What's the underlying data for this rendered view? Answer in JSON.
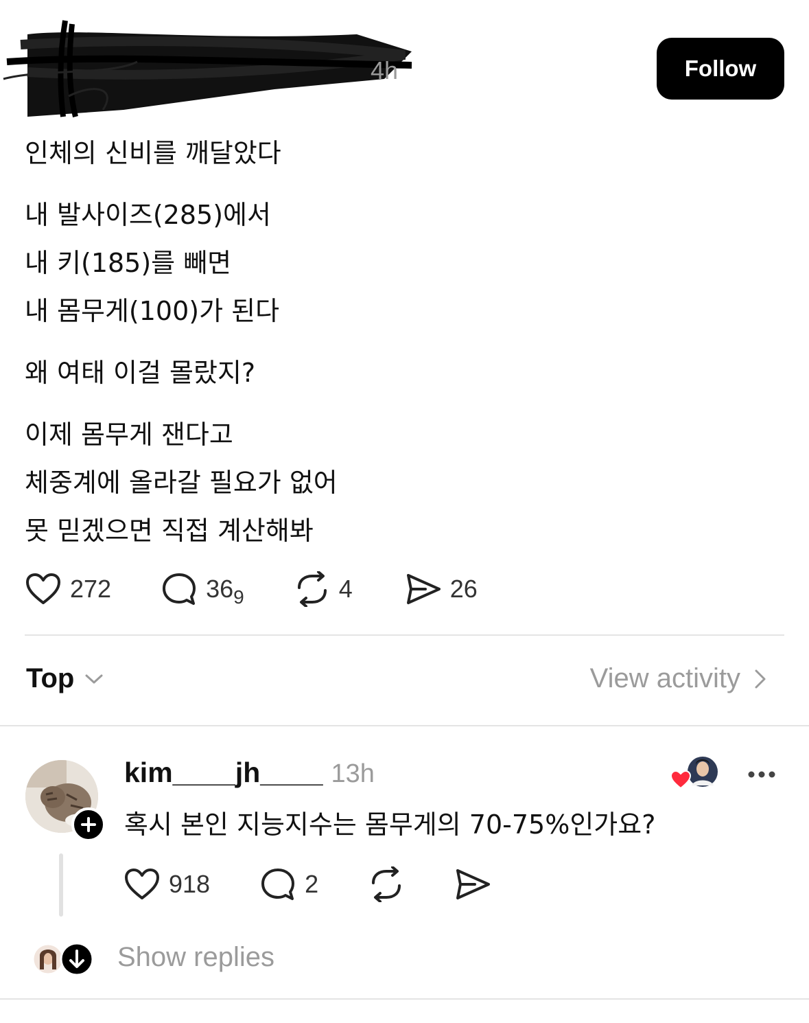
{
  "header": {
    "handle_tail": "4h",
    "follow_label": "Follow"
  },
  "post": {
    "paragraphs": [
      [
        "인체의 신비를 깨달았다"
      ],
      [
        "내 발사이즈(285)에서",
        "내 키(185)를 빼면",
        "내 몸무게(100)가 된다"
      ],
      [
        "왜 여태 이걸 몰랐지?"
      ],
      [
        "이제 몸무게 잰다고",
        "체중계에 올라갈 필요가 없어",
        "못 믿겠으면 직접 계산해봐"
      ]
    ],
    "actions": {
      "likes": "272",
      "replies": "36",
      "replies_sub": "9",
      "reposts": "4",
      "shares": "26"
    }
  },
  "replies_bar": {
    "sort_label": "Top",
    "view_activity": "View activity"
  },
  "comment": {
    "username": "kim____jh____",
    "time": "13h",
    "text": "혹시 본인 지능지수는 몸무게의 70-75%인가요?",
    "likes": "918",
    "replies": "2",
    "show_replies": "Show replies"
  },
  "icons": [
    "heart-icon",
    "comment-icon",
    "repost-icon",
    "share-icon",
    "chevron-down-icon",
    "chevron-right-icon",
    "more-icon",
    "plus-icon",
    "arrow-down-icon"
  ],
  "colors": {
    "follow_bg": "#000000",
    "muted": "#9b9b9b",
    "like_red": "#ff2a3d"
  }
}
